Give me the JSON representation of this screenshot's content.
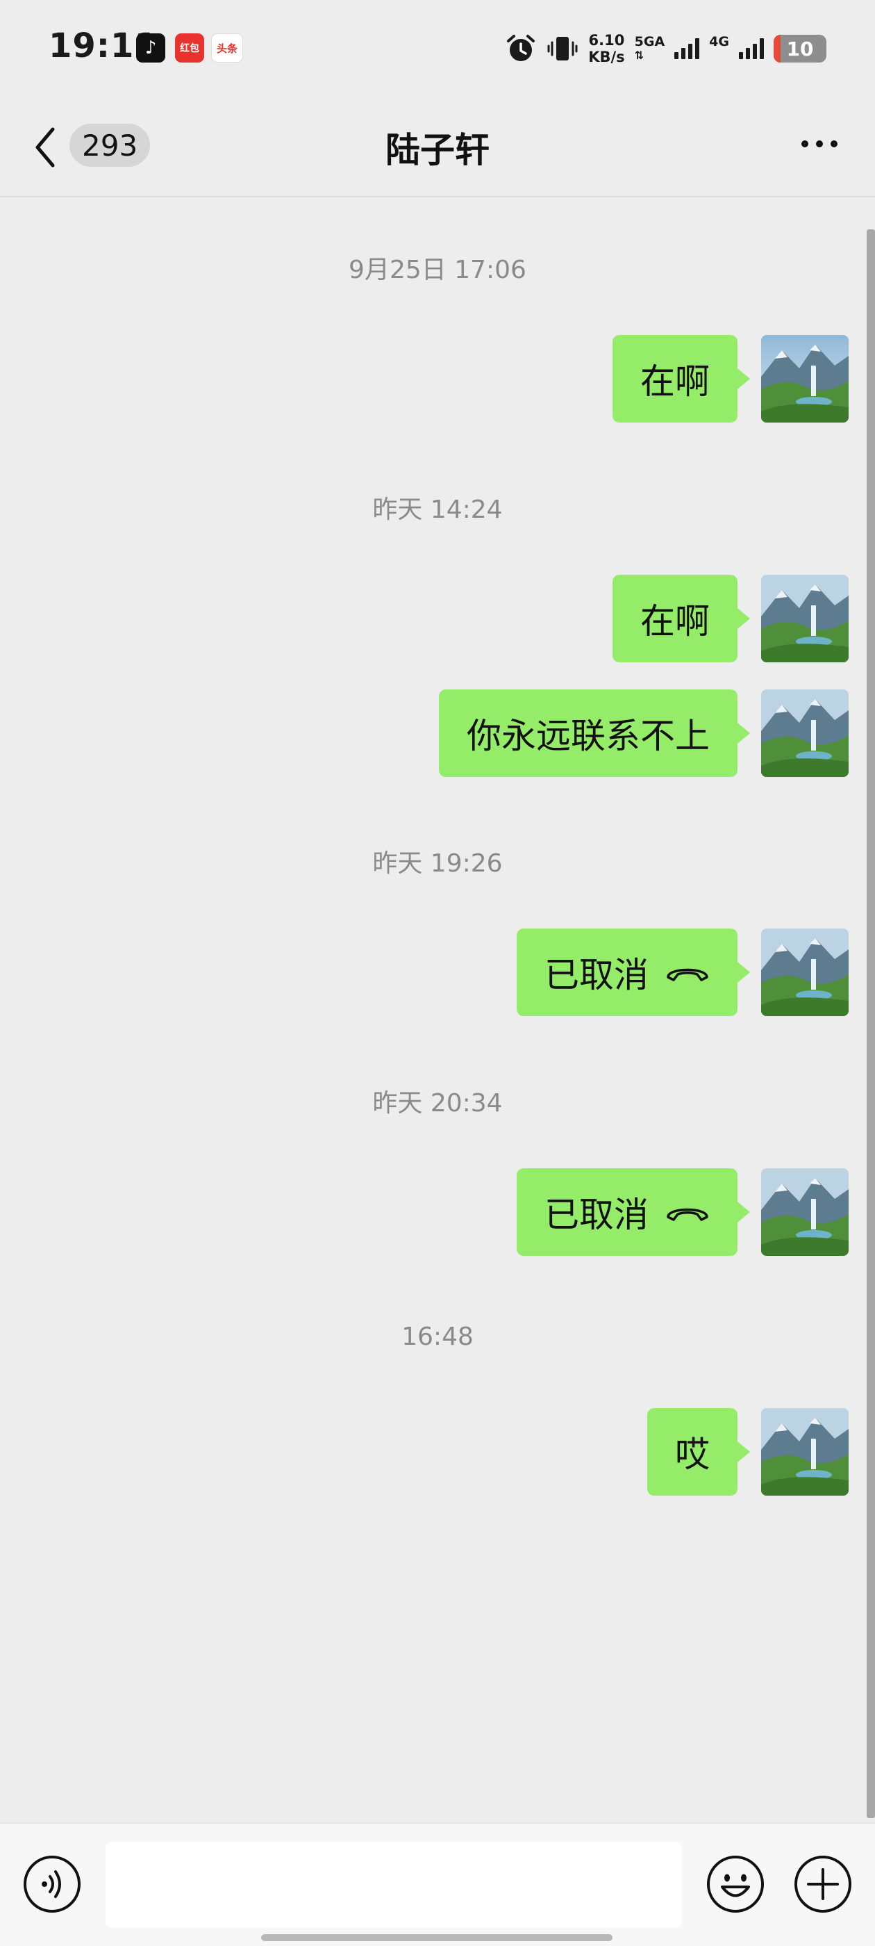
{
  "status_bar": {
    "time": "19:11",
    "apps": [
      {
        "icon": "tiktok-icon",
        "glyph": "♪"
      },
      {
        "icon": "shopping-app-icon",
        "label": "红包"
      },
      {
        "icon": "toutiao-icon",
        "label": "头条"
      }
    ],
    "speed_value": "6.10",
    "speed_unit": "KB/s",
    "network_1": "5GA",
    "network_2": "4G",
    "battery": "10"
  },
  "header": {
    "back_count": "293",
    "title": "陆子轩"
  },
  "messages": [
    {
      "time": "9月25日 17:06",
      "items": [
        {
          "text": "在啊"
        }
      ]
    },
    {
      "time": "昨天 14:24",
      "items": [
        {
          "text": "在啊"
        },
        {
          "text": "你永远联系不上"
        }
      ]
    },
    {
      "time": "昨天 19:26",
      "items": [
        {
          "text": "已取消",
          "icon": "phone-hangup-icon"
        }
      ]
    },
    {
      "time": "昨天 20:34",
      "items": [
        {
          "text": "已取消",
          "icon": "phone-hangup-icon"
        }
      ]
    },
    {
      "time": "16:48",
      "items": [
        {
          "text": "哎"
        }
      ]
    }
  ],
  "input": {
    "value": "",
    "voice_icon": "voice-icon",
    "emoji_icon": "emoji-icon",
    "plus_icon": "plus-icon"
  },
  "colors": {
    "background": "#EDEDED",
    "bubble": "#95EC69",
    "timestamp": "#8A8A8A"
  }
}
